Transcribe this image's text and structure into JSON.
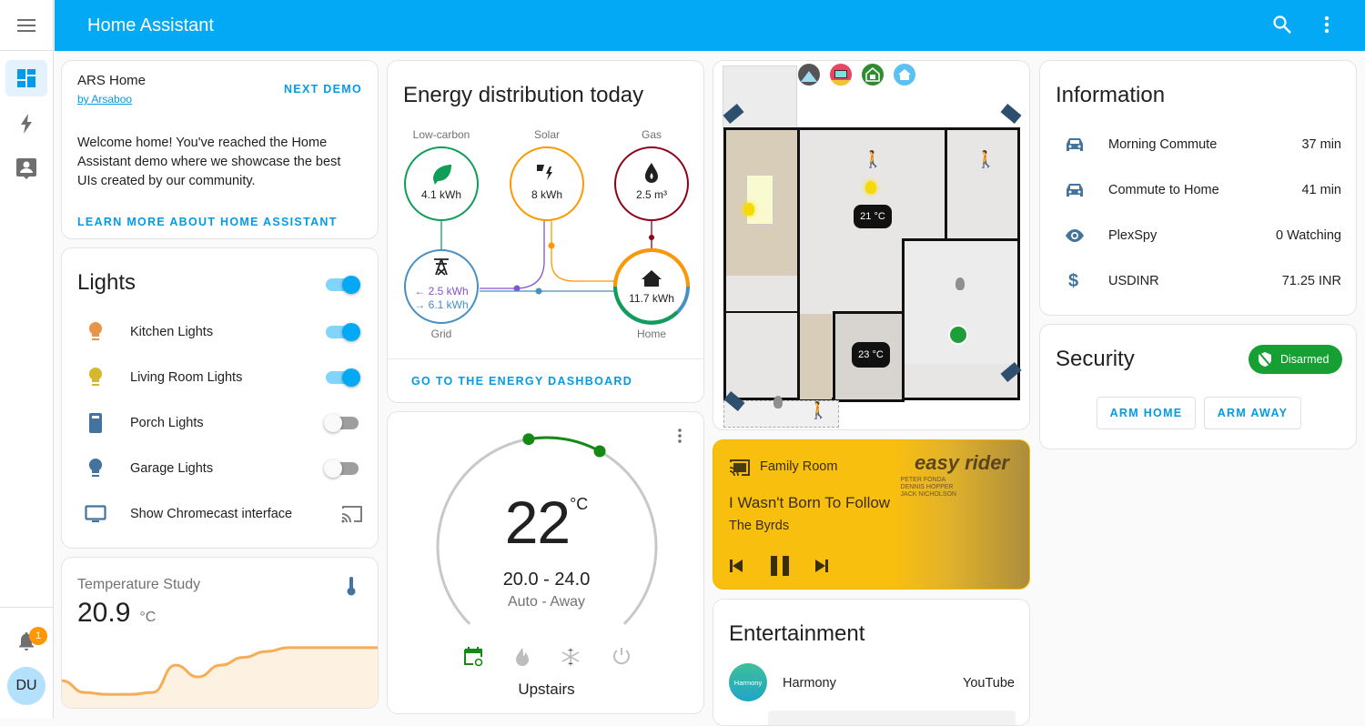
{
  "app": {
    "title": "Home Assistant"
  },
  "header": {
    "search_icon": "search-icon",
    "menu_icon": "dots-vertical-icon"
  },
  "sidebar": {
    "items": [
      {
        "name": "overview",
        "icon": "dashboard-icon",
        "active": true
      },
      {
        "name": "energy",
        "icon": "lightning-bolt-icon",
        "active": false
      },
      {
        "name": "map",
        "icon": "account-box-icon",
        "active": false
      }
    ],
    "notifications_count": "1",
    "user_initials": "DU"
  },
  "demo_card": {
    "title": "ARS Home",
    "author": "by Arsaboo",
    "next_demo": "NEXT DEMO",
    "body": "Welcome home! You've reached the Home Assistant demo where we showcase the best UIs created by our community.",
    "learn_more": "LEARN MORE ABOUT HOME ASSISTANT"
  },
  "lights": {
    "title": "Lights",
    "master_on": true,
    "items": [
      {
        "label": "Kitchen Lights",
        "icon": "lightbulb-icon",
        "icon_color": "#e8944a",
        "on": true
      },
      {
        "label": "Living Room Lights",
        "icon": "lightbulb-icon",
        "icon_color": "#d4b92c",
        "on": true
      },
      {
        "label": "Porch Lights",
        "icon": "light-switch-icon",
        "icon_color": "#44739e",
        "on": false
      },
      {
        "label": "Garage Lights",
        "icon": "lightbulb-icon",
        "icon_color": "#44739e",
        "on": false
      }
    ],
    "chromecast": {
      "label": "Show Chromecast interface",
      "icon": "television-icon",
      "action_icon": "cast-icon"
    }
  },
  "temperature": {
    "title": "Temperature Study",
    "value": "20.9",
    "unit": "°C",
    "icon": "thermometer-icon",
    "history": [
      18.2,
      17.6,
      17.5,
      17.5,
      17.6,
      19.0,
      18.4,
      19.0,
      19.4,
      19.7,
      19.9,
      19.9,
      19.9,
      19.9,
      19.9
    ]
  },
  "energy": {
    "title": "Energy distribution today",
    "nodes": {
      "low_carbon": {
        "label": "Low-carbon",
        "value": "4.1 kWh",
        "color": "#0f9d58"
      },
      "solar": {
        "label": "Solar",
        "value": "8 kWh",
        "color": "#ff9800"
      },
      "gas": {
        "label": "Gas",
        "value": "2.5 m³",
        "color": "#8e021b"
      },
      "grid": {
        "label": "Grid",
        "return": "← 2.5 kWh",
        "consumption": "→ 6.1 kWh",
        "color": "#488fc2",
        "return_color": "#8353d1"
      },
      "home": {
        "label": "Home",
        "value": "11.7 kWh"
      }
    },
    "link": "GO TO THE ENERGY DASHBOARD"
  },
  "thermostat": {
    "current": "22",
    "unit": "°C",
    "range": "20.0 - 24.0",
    "mode": "Auto - Away",
    "name": "Upstairs",
    "low": 20.0,
    "high": 24.0,
    "min": 7,
    "max": 35,
    "modes": [
      {
        "name": "auto",
        "icon": "calendar-sync-icon",
        "active": true
      },
      {
        "name": "heat",
        "icon": "fire-icon",
        "active": false
      },
      {
        "name": "cool",
        "icon": "snowflake-icon",
        "active": false
      },
      {
        "name": "off",
        "icon": "power-icon",
        "active": false
      }
    ]
  },
  "floorplan": {
    "top_icons": [
      "arlo-icon",
      "tv-icon",
      "lock-house-icon",
      "home-icon"
    ],
    "thermostats": [
      "21 °C",
      "23 °C"
    ]
  },
  "media": {
    "device": "Family Room",
    "track": "I Wasn't Born To Follow",
    "artist": "The Byrds",
    "album_art_title": "easy rider",
    "album_art_credits": [
      "PETER FONDA",
      "DENNIS HOPPER",
      "JACK NICHOLSON"
    ],
    "bg_color": "#f9bf0f"
  },
  "entertainment": {
    "title": "Entertainment",
    "items": [
      {
        "logo": "Harmony",
        "label": "Harmony",
        "value": "YouTube"
      }
    ]
  },
  "information": {
    "title": "Information",
    "items": [
      {
        "icon": "car-icon",
        "label": "Morning Commute",
        "value": "37 min"
      },
      {
        "icon": "car-icon",
        "label": "Commute to Home",
        "value": "41 min"
      },
      {
        "icon": "eye-icon",
        "label": "PlexSpy",
        "value": "0 Watching"
      },
      {
        "icon": "currency-usd-icon",
        "label": "USDINR",
        "value": "71.25 INR"
      }
    ]
  },
  "security": {
    "title": "Security",
    "state": "Disarmed",
    "arm_home": "ARM HOME",
    "arm_away": "ARM AWAY"
  }
}
